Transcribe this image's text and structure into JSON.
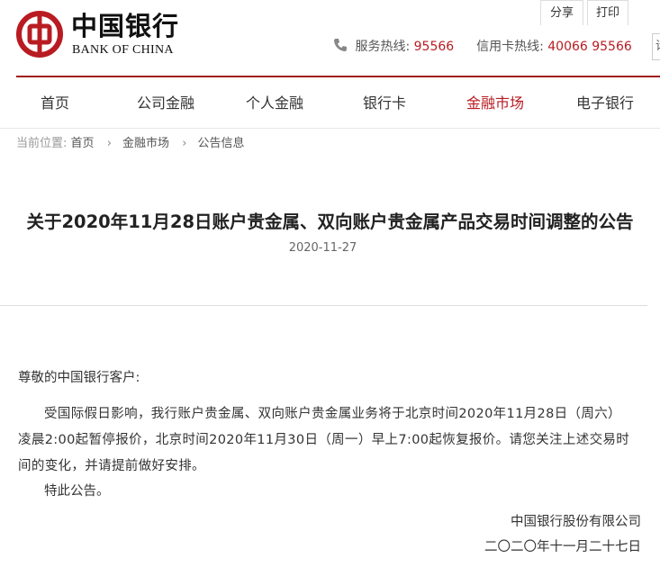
{
  "header": {
    "brand_cn": "中国银行",
    "brand_en": "BANK OF CHINA",
    "service_label": "服务热线:",
    "service_number": "95566",
    "card_label": "信用卡热线:",
    "card_number": "40066 95566",
    "search_stub": "请",
    "brand_color": "#b81c22",
    "icons": [
      "boc-logo",
      "phone-icon"
    ]
  },
  "nav": {
    "items": [
      {
        "label": "首页",
        "active": false
      },
      {
        "label": "公司金融",
        "active": false
      },
      {
        "label": "个人金融",
        "active": false
      },
      {
        "label": "银行卡",
        "active": false
      },
      {
        "label": "金融市场",
        "active": true
      },
      {
        "label": "电子银行",
        "active": false
      }
    ]
  },
  "breadcrumb": {
    "lead": "当前位置:",
    "items": [
      "首页",
      "金融市场",
      "公告信息"
    ],
    "separator": "›"
  },
  "article": {
    "title": "关于2020年11月28日账户贵金属、双向账户贵金属产品交易时间调整的公告",
    "date": "2020-11-27",
    "share_label": "分享",
    "print_label": "打印",
    "greeting": "尊敬的中国银行客户:",
    "paragraph": "受国际假日影响，我行账户贵金属、双向账户贵金属业务将于北京时间2020年11月28日（周六）凌晨2:00起暂停报价，北京时间2020年11月30日（周一）早上7:00起恢复报价。请您关注上述交易时间的变化，并请提前做好安排。",
    "closing": "特此公告。",
    "signature_org": "中国银行股份有限公司",
    "signature_date": "二〇二〇年十一月二十七日"
  }
}
